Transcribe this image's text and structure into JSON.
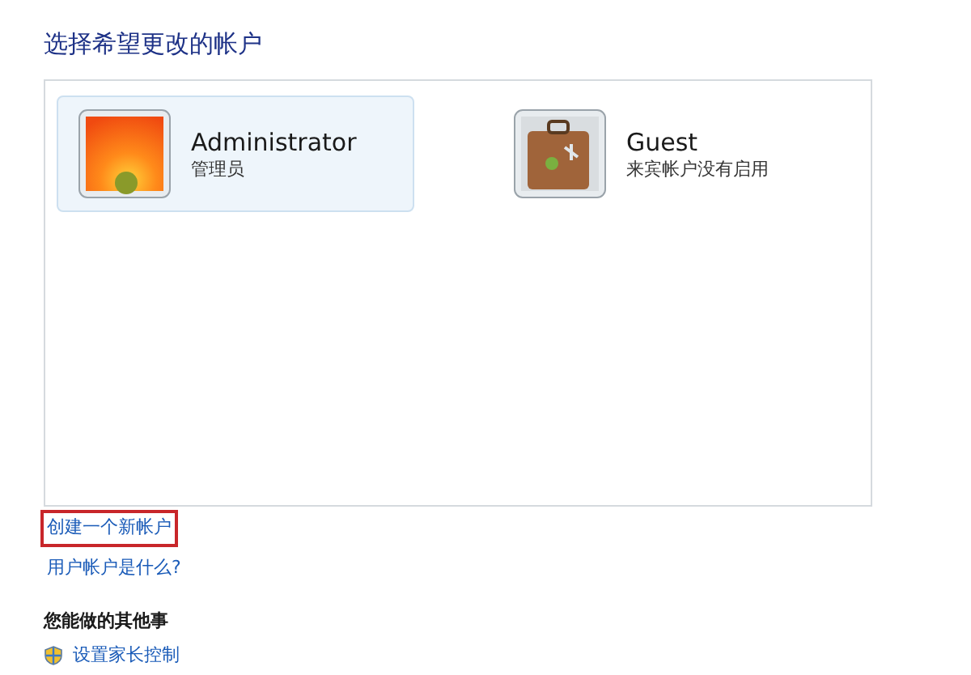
{
  "title": "选择希望更改的帐户",
  "accounts": [
    {
      "name": "Administrator",
      "description": "管理员",
      "kind": "flower",
      "selected": true
    },
    {
      "name": "Guest",
      "description": "来宾帐户没有启用",
      "kind": "suitcase",
      "selected": false
    }
  ],
  "links": [
    {
      "label": "创建一个新帐户",
      "highlighted": true
    },
    {
      "label": "用户帐户是什么?",
      "highlighted": false
    }
  ],
  "other_tasks": {
    "heading": "您能做的其他事",
    "items": [
      {
        "label": "设置家长控制"
      }
    ]
  }
}
